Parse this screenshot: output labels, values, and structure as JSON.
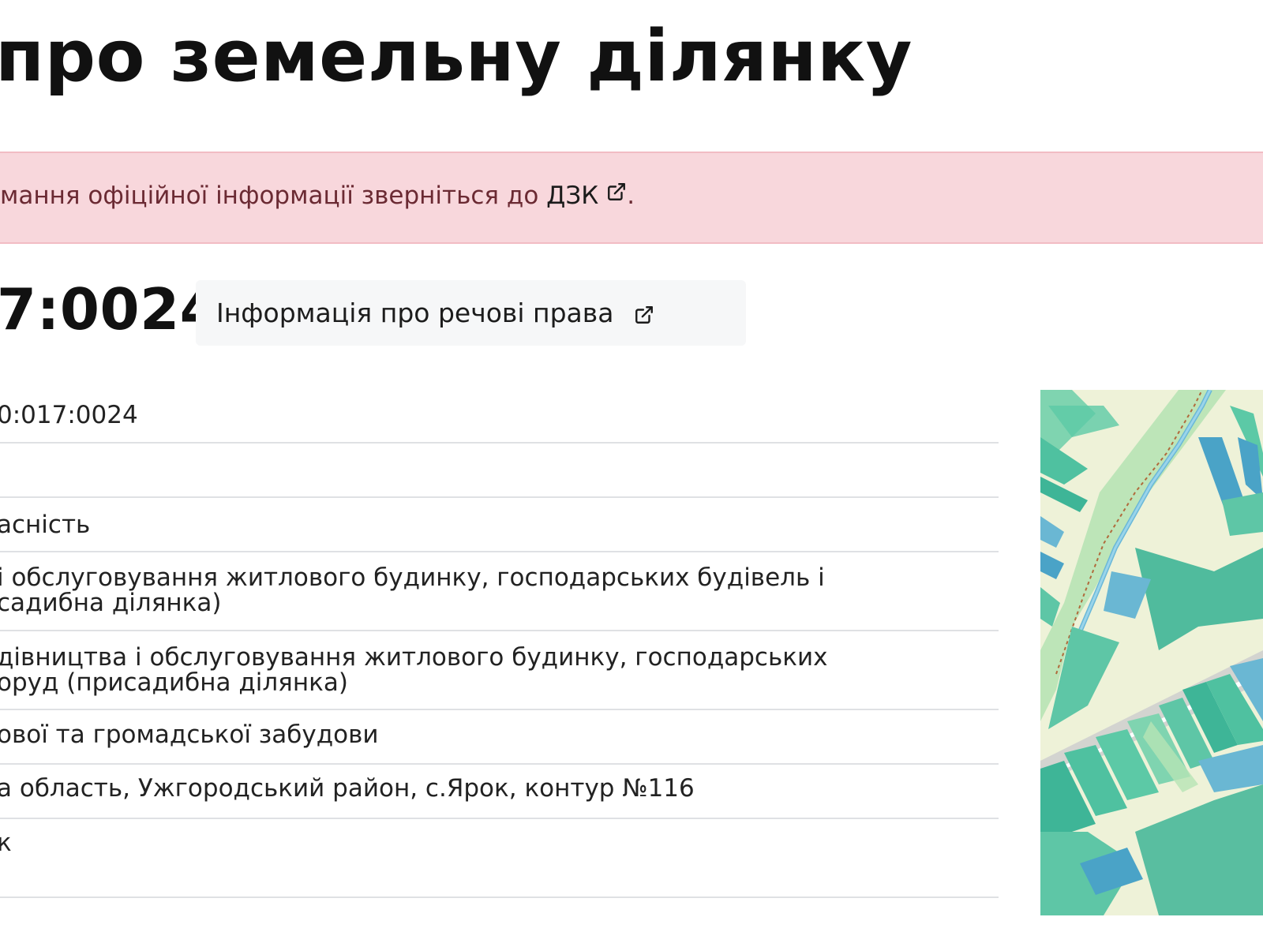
{
  "page": {
    "title": "про земельну ділянку"
  },
  "alert": {
    "text": "мання офіційної інформації зверніться до ",
    "link_label": "ДЗК",
    "suffix": ".",
    "icon": "external-link-icon"
  },
  "parcel": {
    "cadastral_number": "7:0024",
    "rights_button_label": "Інформація про речові права",
    "rights_button_icon": "external-link-icon"
  },
  "info_rows": [
    {
      "lines": [
        "0:017:0024"
      ]
    },
    {
      "lines": [
        ""
      ]
    },
    {
      "lines": [
        "асність"
      ]
    },
    {
      "lines": [
        "і обслуговування житлового будинку, господарських будівель і",
        "садибна ділянка)"
      ]
    },
    {
      "lines": [
        "дівництва і обслуговування житлового будинку, господарських",
        "оруд (присадибна ділянка)"
      ]
    },
    {
      "lines": [
        "ової та громадської забудови"
      ]
    },
    {
      "lines": [
        "а область, Ужгородський район, с.Ярок, контур №116"
      ]
    },
    {
      "lines": [
        "к"
      ]
    }
  ],
  "map": {
    "icon": "cadastral-map-thumbnail"
  },
  "colors": {
    "alert_bg": "#f8d7dc",
    "alert_text": "#6b2a33",
    "divider": "#dfe1e4",
    "button_bg": "#f6f7f8"
  }
}
